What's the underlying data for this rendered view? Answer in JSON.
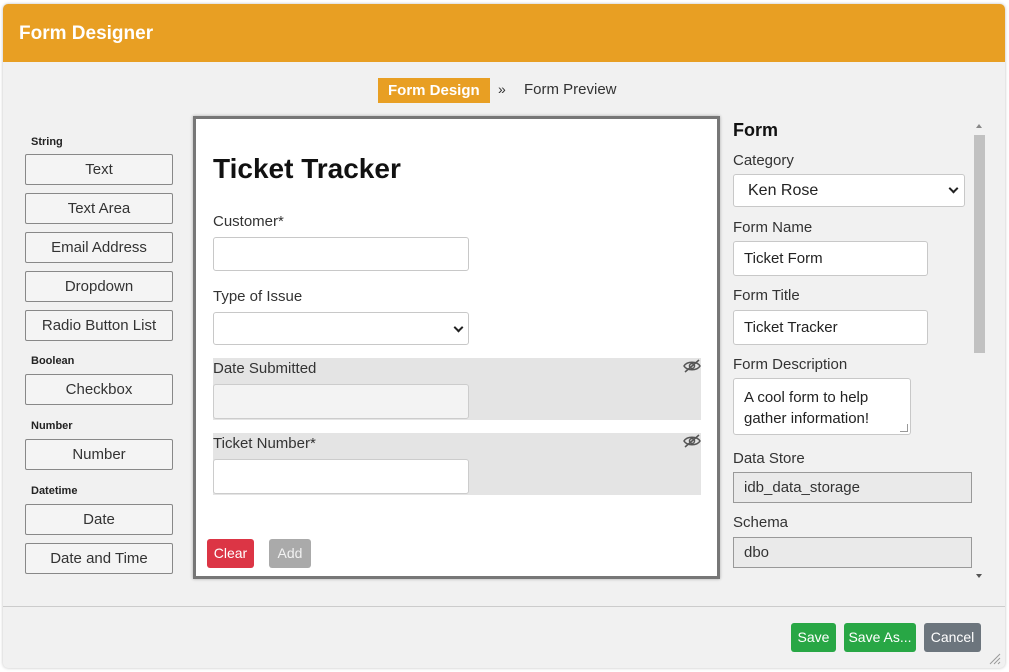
{
  "window": {
    "title": "Form Designer"
  },
  "steps": {
    "active": "Form Design",
    "separator": "»",
    "next": "Form Preview"
  },
  "palette": {
    "groups": {
      "string": "String",
      "boolean": "Boolean",
      "number": "Number",
      "datetime": "Datetime"
    },
    "items": {
      "text": "Text",
      "text_area": "Text Area",
      "email": "Email Address",
      "dropdown": "Dropdown",
      "radio": "Radio Button List",
      "checkbox": "Checkbox",
      "number": "Number",
      "date": "Date",
      "date_time": "Date and Time"
    }
  },
  "canvas": {
    "title": "Ticket Tracker",
    "fields": {
      "customer": "Customer*",
      "type_of_issue": "Type of Issue",
      "date_submitted": "Date Submitted",
      "ticket_number": "Ticket Number*"
    },
    "buttons": {
      "clear": "Clear",
      "add": "Add"
    },
    "icons": {
      "hidden": "eye-slash-icon"
    }
  },
  "properties": {
    "heading": "Form",
    "category_label": "Category",
    "category_value": "Ken Rose",
    "form_name_label": "Form Name",
    "form_name_value": "Ticket Form",
    "form_title_label": "Form Title",
    "form_title_value": "Ticket Tracker",
    "form_description_label": "Form Description",
    "form_description_value": "A cool form to help gather information!",
    "data_store_label": "Data Store",
    "data_store_value": "idb_data_storage",
    "schema_label": "Schema",
    "schema_value": "dbo"
  },
  "footer": {
    "save": "Save",
    "save_as": "Save As...",
    "cancel": "Cancel"
  },
  "colors": {
    "header": "#e89f23",
    "danger": "#dc3545",
    "success": "#28a745",
    "secondary": "#6c757d",
    "disabled": "#aaaaaa"
  }
}
